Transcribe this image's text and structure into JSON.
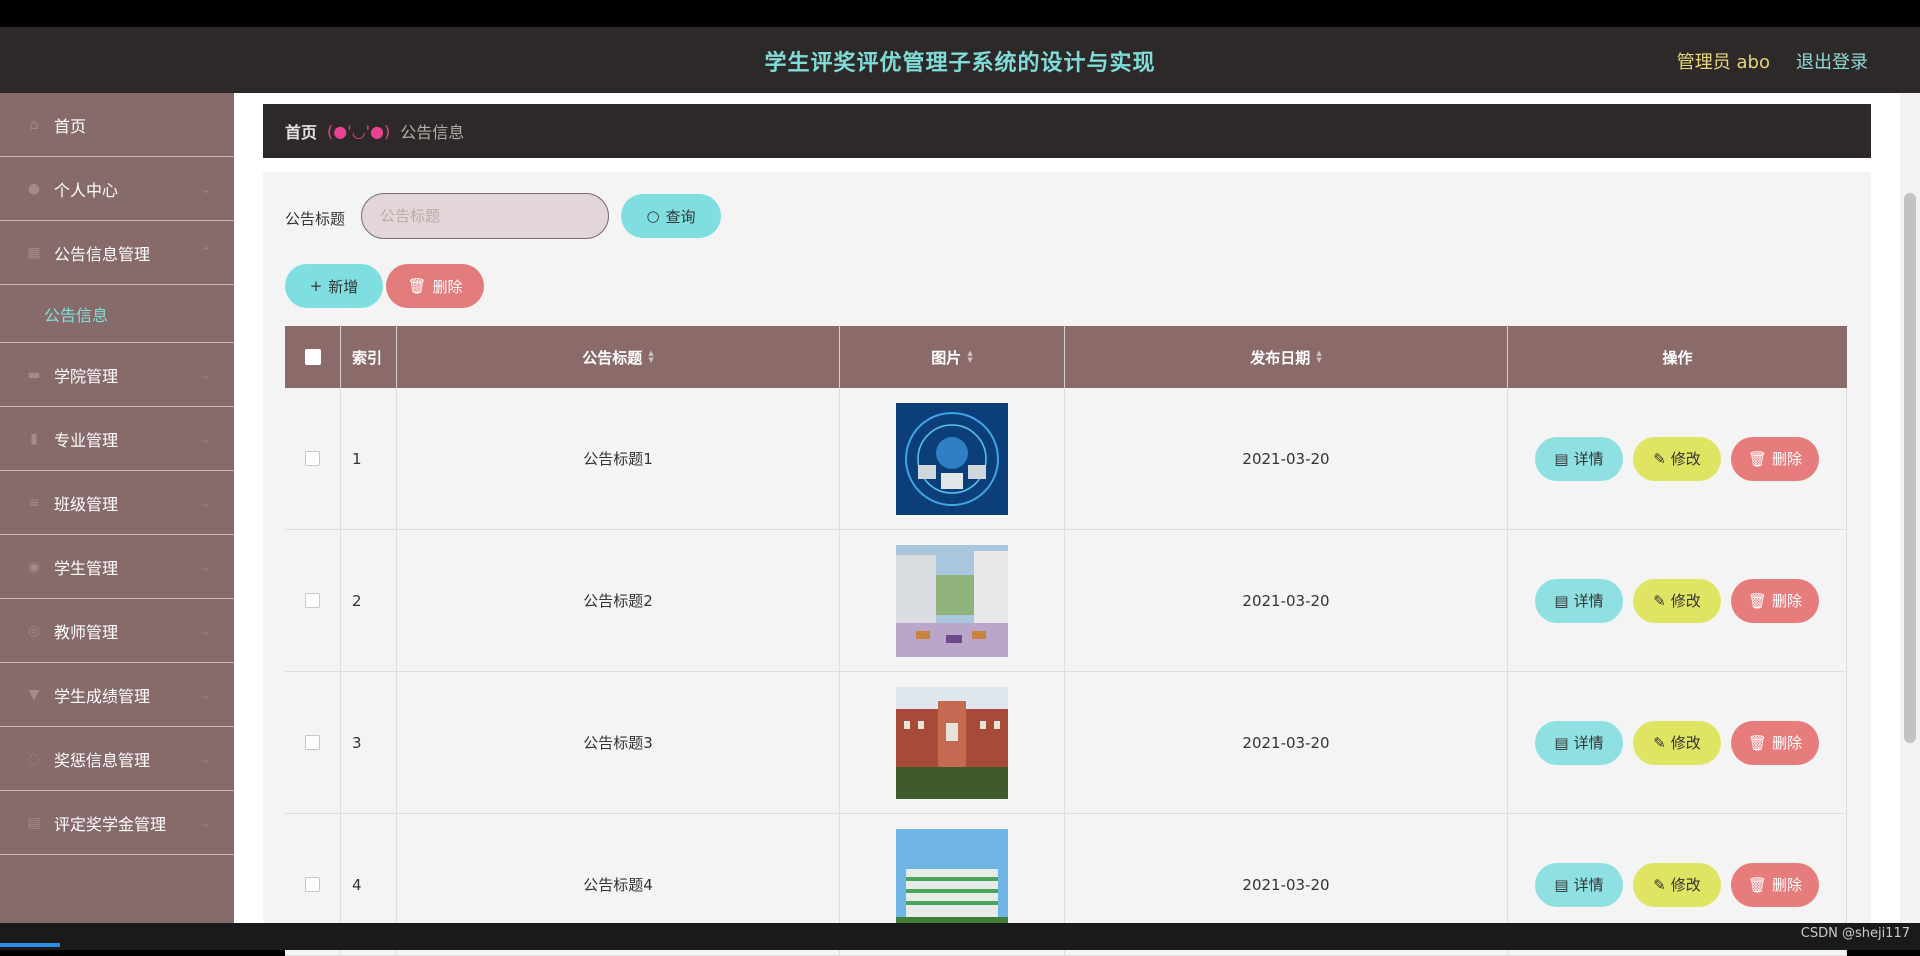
{
  "header": {
    "title": "学生评奖评优管理子系统的设计与实现",
    "admin": "管理员 abo",
    "logout": "退出登录"
  },
  "sidebar": {
    "items": [
      {
        "label": "首页",
        "icon": "home-icon"
      },
      {
        "label": "个人中心",
        "icon": "user-icon"
      },
      {
        "label": "公告信息管理",
        "icon": "grid-icon"
      },
      {
        "label": "学院管理",
        "icon": "folder-icon"
      },
      {
        "label": "专业管理",
        "icon": "book-icon"
      },
      {
        "label": "班级管理",
        "icon": "list-icon"
      },
      {
        "label": "学生管理",
        "icon": "location-icon"
      },
      {
        "label": "教师管理",
        "icon": "globe-icon"
      },
      {
        "label": "学生成绩管理",
        "icon": "trophy-icon"
      },
      {
        "label": "奖惩信息管理",
        "icon": "circle-icon"
      },
      {
        "label": "评定奖学金管理",
        "icon": "calendar-icon"
      }
    ],
    "subitem": "公告信息"
  },
  "breadcrumb": {
    "home": "首页",
    "separator": "(●'◡'●)",
    "current": "公告信息"
  },
  "search": {
    "label": "公告标题",
    "placeholder": "公告标题",
    "button": "查询"
  },
  "actions": {
    "add": "新增",
    "delete": "删除"
  },
  "table": {
    "headers": {
      "index": "索引",
      "title": "公告标题",
      "image": "图片",
      "date": "发布日期",
      "ops": "操作"
    },
    "rows": [
      {
        "index": "1",
        "title": "公告标题1",
        "date": "2021-03-20",
        "image": "globe-tech"
      },
      {
        "index": "2",
        "title": "公告标题2",
        "date": "2021-03-20",
        "image": "courtyard"
      },
      {
        "index": "3",
        "title": "公告标题3",
        "date": "2021-03-20",
        "image": "campus-building"
      },
      {
        "index": "4",
        "title": "公告标题4",
        "date": "2021-03-20",
        "image": "modern-building"
      }
    ],
    "row_buttons": {
      "detail": "详情",
      "edit": "修改",
      "delete": "删除"
    }
  },
  "watermark": "CSDN @sheji117",
  "colors": {
    "topbar": "#2e2929",
    "sidebar": "#876a6a",
    "accent_cyan": "#7fdfe0",
    "accent_yellow": "#e0e463",
    "accent_red": "#e67c7c",
    "table_header": "#8a6b6a"
  }
}
